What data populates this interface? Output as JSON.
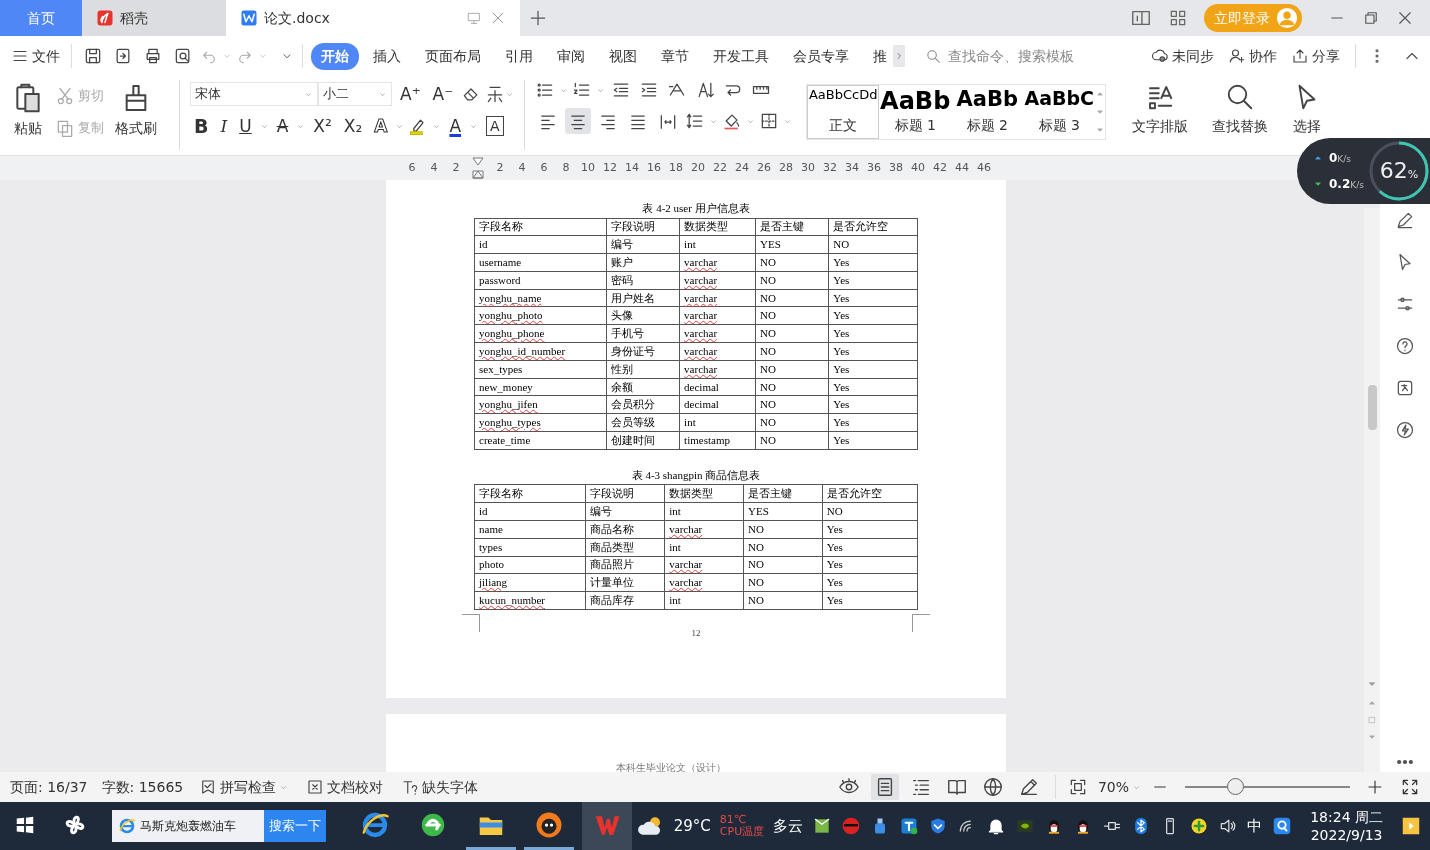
{
  "tabs": [
    {
      "label": "首页",
      "kind": "home",
      "selected": false
    },
    {
      "label": "稻壳",
      "kind": "docer",
      "selected": false
    },
    {
      "label": "论文.docx",
      "kind": "document",
      "selected": true
    }
  ],
  "login_button": "立即登录",
  "menu": {
    "file": "文件",
    "ribbon_tabs": [
      {
        "label": "开始",
        "selected": true
      },
      {
        "label": "插入",
        "selected": false
      },
      {
        "label": "页面布局",
        "selected": false
      },
      {
        "label": "引用",
        "selected": false
      },
      {
        "label": "审阅",
        "selected": false
      },
      {
        "label": "视图",
        "selected": false
      },
      {
        "label": "章节",
        "selected": false
      },
      {
        "label": "开发工具",
        "selected": false
      },
      {
        "label": "会员专享",
        "selected": false
      },
      {
        "label": "推",
        "selected": false
      }
    ],
    "search": {
      "placeholder": "查找命令、搜索模板"
    },
    "actions": [
      {
        "kind": "sync",
        "label": "未同步"
      },
      {
        "kind": "collab",
        "label": "协作"
      },
      {
        "kind": "share",
        "label": "分享"
      }
    ]
  },
  "ribbon": {
    "clipboard": [
      {
        "kind": "paste",
        "label": "粘贴",
        "disabled": false
      },
      {
        "kind": "cut",
        "label": "剪切",
        "disabled": true
      },
      {
        "kind": "copy",
        "label": "复制",
        "disabled": true
      },
      {
        "kind": "brush",
        "label": "格式刷",
        "disabled": false
      }
    ],
    "font_name": "宋体",
    "font_size": "小二",
    "size_buttons": [
      "A⁺",
      "A⁻"
    ],
    "format_buttons": [
      {
        "kind": "bold",
        "glyph": "B"
      },
      {
        "kind": "italic",
        "glyph": "I"
      },
      {
        "kind": "underline",
        "glyph": "U"
      },
      {
        "kind": "strike",
        "glyph": "A"
      },
      {
        "kind": "plain",
        "glyph": "X²"
      },
      {
        "kind": "plain",
        "glyph": "X₂"
      },
      {
        "kind": "outline",
        "glyph": "A"
      },
      {
        "kind": "color",
        "glyph": "A"
      },
      {
        "kind": "boxed",
        "glyph": "A"
      }
    ],
    "align_buttons": [
      {
        "selected": false
      },
      {
        "selected": true
      },
      {
        "selected": false
      },
      {
        "selected": false
      },
      {
        "selected": false
      }
    ],
    "styles": [
      {
        "preview": "AaBbCcDd",
        "label": "正文",
        "kind": "body",
        "selected": true
      },
      {
        "preview": "AaBb",
        "label": "标题 1",
        "kind": "h1",
        "selected": false
      },
      {
        "preview": "AaBb",
        "label": "标题 2",
        "kind": "h2",
        "selected": false
      },
      {
        "preview": "AaBbC",
        "label": "标题 3",
        "kind": "h3",
        "selected": false
      }
    ],
    "tools": [
      {
        "kind": "layout",
        "label": "文字排版"
      },
      {
        "kind": "find",
        "label": "查找替换"
      },
      {
        "kind": "select",
        "label": "选择"
      }
    ]
  },
  "ruler": {
    "left_ticks": [
      "6",
      "4",
      "2"
    ],
    "right_ticks": [
      "2",
      "4",
      "6",
      "8",
      "10",
      "12",
      "14",
      "16",
      "18",
      "20",
      "22",
      "24",
      "26",
      "28",
      "30",
      "32",
      "34",
      "36",
      "38",
      "40",
      "42",
      "44",
      "46"
    ]
  },
  "document": {
    "tables": [
      {
        "caption": "表 4-2 user 用户信息表",
        "columns": [
          "字段名称",
          "字段说明",
          "数据类型",
          "是否主键",
          "是否允许空"
        ],
        "rows": [
          {
            "cells": [
              "id",
              "编号",
              "int",
              "YES",
              "NO"
            ],
            "spell_flags": [
              false,
              false,
              false,
              false,
              false
            ]
          },
          {
            "cells": [
              "username",
              "账户",
              "varchar",
              "NO",
              "Yes"
            ],
            "spell_flags": [
              false,
              false,
              true,
              false,
              false
            ]
          },
          {
            "cells": [
              "password",
              "密码",
              "varchar",
              "NO",
              "Yes"
            ],
            "spell_flags": [
              false,
              false,
              true,
              false,
              false
            ]
          },
          {
            "cells": [
              "yonghu_name",
              "用户姓名",
              "varchar",
              "NO",
              "Yes"
            ],
            "spell_flags": [
              true,
              false,
              true,
              false,
              false
            ]
          },
          {
            "cells": [
              "yonghu_photo",
              "头像",
              "varchar",
              "NO",
              "Yes"
            ],
            "spell_flags": [
              true,
              false,
              true,
              false,
              false
            ]
          },
          {
            "cells": [
              "yonghu_phone",
              "手机号",
              "varchar",
              "NO",
              "Yes"
            ],
            "spell_flags": [
              true,
              false,
              true,
              false,
              false
            ]
          },
          {
            "cells": [
              "yonghu_id_number",
              "身份证号",
              "varchar",
              "NO",
              "Yes"
            ],
            "spell_flags": [
              true,
              false,
              true,
              false,
              false
            ]
          },
          {
            "cells": [
              "sex_types",
              "性别",
              "varchar",
              "NO",
              "Yes"
            ],
            "spell_flags": [
              false,
              false,
              true,
              false,
              false
            ]
          },
          {
            "cells": [
              "new_money",
              "余额",
              "decimal",
              "NO",
              "Yes"
            ],
            "spell_flags": [
              false,
              false,
              false,
              false,
              false
            ]
          },
          {
            "cells": [
              "yonghu_jifen",
              "会员积分",
              "decimal",
              "NO",
              "Yes"
            ],
            "spell_flags": [
              true,
              false,
              false,
              false,
              false
            ]
          },
          {
            "cells": [
              "yonghu_types",
              "会员等级",
              "int",
              "NO",
              "Yes"
            ],
            "spell_flags": [
              true,
              false,
              false,
              false,
              false
            ]
          },
          {
            "cells": [
              "create_time",
              "创建时间",
              "timestamp",
              "NO",
              "Yes"
            ],
            "spell_flags": [
              false,
              false,
              false,
              false,
              false
            ]
          }
        ]
      },
      {
        "caption": "表 4-3 shangpin 商品信息表",
        "columns": [
          "字段名称",
          "字段说明",
          "数据类型",
          "是否主键",
          "是否允许空"
        ],
        "rows": [
          {
            "cells": [
              "id",
              "编号",
              "int",
              "YES",
              "NO"
            ],
            "spell_flags": [
              false,
              false,
              false,
              false,
              false
            ]
          },
          {
            "cells": [
              "name",
              "商品名称",
              "varchar",
              "NO",
              "Yes"
            ],
            "spell_flags": [
              false,
              false,
              true,
              false,
              false
            ]
          },
          {
            "cells": [
              "types",
              "商品类型",
              "int",
              "NO",
              "Yes"
            ],
            "spell_flags": [
              false,
              false,
              false,
              false,
              false
            ]
          },
          {
            "cells": [
              "photo",
              "商品照片",
              "varchar",
              "NO",
              "Yes"
            ],
            "spell_flags": [
              false,
              false,
              true,
              false,
              false
            ]
          },
          {
            "cells": [
              "jiliang",
              "计量单位",
              "varchar",
              "NO",
              "Yes"
            ],
            "spell_flags": [
              true,
              false,
              true,
              false,
              false
            ]
          },
          {
            "cells": [
              "kucun_number",
              "商品库存",
              "int",
              "NO",
              "Yes"
            ],
            "spell_flags": [
              true,
              false,
              false,
              false,
              false
            ]
          }
        ]
      }
    ],
    "page_number": "12",
    "next_page_header": "本科生毕业论文（设计）"
  },
  "net_monitor": {
    "upload": "0",
    "download": "0.2",
    "unit_up": "K/s",
    "unit_down": "K/s",
    "percent": "62",
    "percent_sign": "%",
    "level": 0.62
  },
  "status_bar": {
    "page": "页面: 16/37",
    "words": "字数: 15665",
    "tools": [
      {
        "kind": "spell",
        "label": "拼写检查"
      },
      {
        "kind": "proof",
        "label": "文档校对"
      },
      {
        "kind": "font",
        "label": "缺失字体"
      }
    ],
    "view_buttons": [
      {
        "kind": "eye",
        "selected": false
      },
      {
        "kind": "page",
        "selected": true
      },
      {
        "kind": "outline",
        "selected": false
      },
      {
        "kind": "book",
        "selected": false
      },
      {
        "kind": "web",
        "selected": false
      },
      {
        "kind": "pen",
        "selected": false
      }
    ],
    "zoom": "70%",
    "zoom_slider": {
      "level": 0.3
    }
  },
  "taskbar": {
    "search_text": "马斯克炮轰燃油车",
    "search_button": "搜索一下",
    "apps": [
      {
        "kind": "ie",
        "running": false,
        "selected": false
      },
      {
        "kind": "browser",
        "running": false,
        "selected": false
      },
      {
        "kind": "folder",
        "running": true,
        "selected": false
      },
      {
        "kind": "game",
        "running": true,
        "selected": false
      },
      {
        "kind": "wps",
        "running": false,
        "selected": true
      }
    ],
    "weather": {
      "temp": "29°C",
      "desc": "多云"
    },
    "cpu": {
      "temp": "81℃",
      "label": "CPU温度"
    },
    "ime": "中",
    "time": "18:24 周二",
    "date": "2022/9/13"
  }
}
